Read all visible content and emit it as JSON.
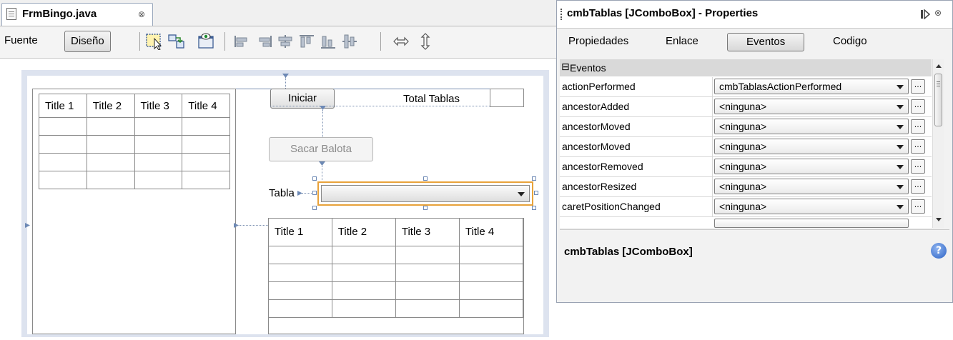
{
  "editor": {
    "tab": {
      "label": "FrmBingo.java",
      "close_glyph": "⊗"
    },
    "toolbar": {
      "source_label": "Fuente",
      "design_label": "Diseño"
    },
    "form": {
      "table_headers": [
        "Title 1",
        "Title 2",
        "Title 3",
        "Title 4"
      ],
      "btn_iniciar": "Iniciar",
      "label_total_tablas": "Total Tablas",
      "btn_sacar_balota": "Sacar Balota",
      "label_tabla": "Tabla"
    }
  },
  "properties": {
    "title": "cmbTablas [JComboBox] - Properties",
    "tabs": [
      "Propiedades",
      "Enlace",
      "Eventos",
      "Codigo"
    ],
    "active_tab": "Eventos",
    "category": "Eventos",
    "category_toggle": "⊟",
    "rows": [
      {
        "name": "actionPerformed",
        "value": "cmbTablasActionPerformed"
      },
      {
        "name": "ancestorAdded",
        "value": "<ninguna>"
      },
      {
        "name": "ancestorMoved",
        "value": "<ninguna>"
      },
      {
        "name": "ancestorMoved",
        "value": "<ninguna>"
      },
      {
        "name": "ancestorRemoved",
        "value": "<ninguna>"
      },
      {
        "name": "ancestorResized",
        "value": "<ninguna>"
      },
      {
        "name": "caretPositionChanged",
        "value": "<ninguna>"
      }
    ],
    "ellipsis": "...",
    "description_title": "cmbTablas [JComboBox]",
    "help_glyph": "?",
    "colors": {
      "selection": "#e8a23a",
      "anchor": "#6d89b5",
      "help": "#2c63c5"
    }
  }
}
